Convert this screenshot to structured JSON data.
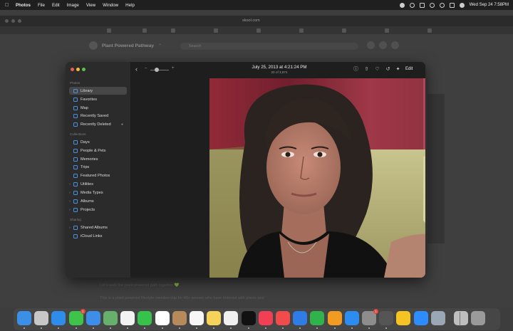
{
  "menubar": {
    "app": "Photos",
    "items": [
      "File",
      "Edit",
      "Image",
      "View",
      "Window",
      "Help"
    ],
    "clock": "Wed Sep 24  7:58PM"
  },
  "safari": {
    "url": "skool.com",
    "site_title": "Plant Powered Pathway",
    "search_placeholder": "Search",
    "bg_text_1": "Let's walk the plant powered path together 💚",
    "bg_text_2": "This is a plant powered lifestyle membership for 40+ women who have tinkered with plants and"
  },
  "photos": {
    "sections": {
      "photos": "Photos",
      "collections": "Collections",
      "sharing": "Sharing"
    },
    "photos_items": [
      {
        "label": "Library",
        "icon": "library-icon",
        "selected": true
      },
      {
        "label": "Favorites",
        "icon": "heart-icon"
      },
      {
        "label": "Map",
        "icon": "map-icon"
      },
      {
        "label": "Recently Saved",
        "icon": "download-icon"
      },
      {
        "label": "Recently Deleted",
        "icon": "trash-icon"
      }
    ],
    "collection_items": [
      {
        "label": "Days",
        "icon": "calendar-icon"
      },
      {
        "label": "People & Pets",
        "icon": "person-icon"
      },
      {
        "label": "Memories",
        "icon": "memories-icon"
      },
      {
        "label": "Trips",
        "icon": "suitcase-icon"
      },
      {
        "label": "Featured Photos",
        "icon": "photo-icon"
      },
      {
        "label": "Utilities",
        "icon": "utilities-icon"
      },
      {
        "label": "Media Types",
        "icon": "media-types-icon"
      },
      {
        "label": "Albums",
        "icon": "album-icon"
      },
      {
        "label": "Projects",
        "icon": "projects-icon"
      }
    ],
    "sharing_items": [
      {
        "label": "Shared Albums",
        "icon": "shared-album-icon"
      },
      {
        "label": "iCloud Links",
        "icon": "link-icon"
      }
    ],
    "toolbar": {
      "date": "July 25, 2013 at 4:21:24 PM",
      "count": "20 of 3,974",
      "edit_label": "Edit"
    }
  },
  "dock": {
    "apps": [
      {
        "name": "Finder",
        "color": "#3b8fe6"
      },
      {
        "name": "Launchpad",
        "color": "#c7c7c7"
      },
      {
        "name": "Safari",
        "color": "#2f8ce8"
      },
      {
        "name": "Messages",
        "color": "#3ec44b",
        "badge": "1"
      },
      {
        "name": "Mail",
        "color": "#3d8ee8"
      },
      {
        "name": "Maps",
        "color": "#67b06b"
      },
      {
        "name": "Photos",
        "color": "#f2f2f2"
      },
      {
        "name": "FaceTime",
        "color": "#36c24b"
      },
      {
        "name": "Calendar",
        "color": "#ffffff"
      },
      {
        "name": "Contacts",
        "color": "#b78a5c"
      },
      {
        "name": "Reminders",
        "color": "#f7f7f7"
      },
      {
        "name": "Notes",
        "color": "#f5d35a"
      },
      {
        "name": "Freeform",
        "color": "#f0f0f0"
      },
      {
        "name": "TV",
        "color": "#111111"
      },
      {
        "name": "Music",
        "color": "#f23f53"
      },
      {
        "name": "News",
        "color": "#f24b4b"
      },
      {
        "name": "Keynote",
        "color": "#2f7ce6"
      },
      {
        "name": "Numbers",
        "color": "#2fb34a"
      },
      {
        "name": "Pages",
        "color": "#f29b23"
      },
      {
        "name": "App Store",
        "color": "#2d8cf0"
      },
      {
        "name": "System Settings",
        "color": "#8d8d8d",
        "badge": "1"
      },
      {
        "name": "iPhone Mirroring",
        "color": "#555555"
      },
      {
        "name": "Tips",
        "color": "#f5c424"
      },
      {
        "name": "Zoom",
        "color": "#2d8cff"
      },
      {
        "name": "Preview",
        "color": "#9aa7b5"
      },
      {
        "name": "Downloads",
        "color": "#bfbfbf"
      },
      {
        "name": "Trash",
        "color": "#9a9a9a"
      }
    ]
  },
  "colors": {
    "accent": "#4a90e2",
    "window_bg": "#1e1e1e",
    "sidebar_bg": "#2b2b2b"
  }
}
